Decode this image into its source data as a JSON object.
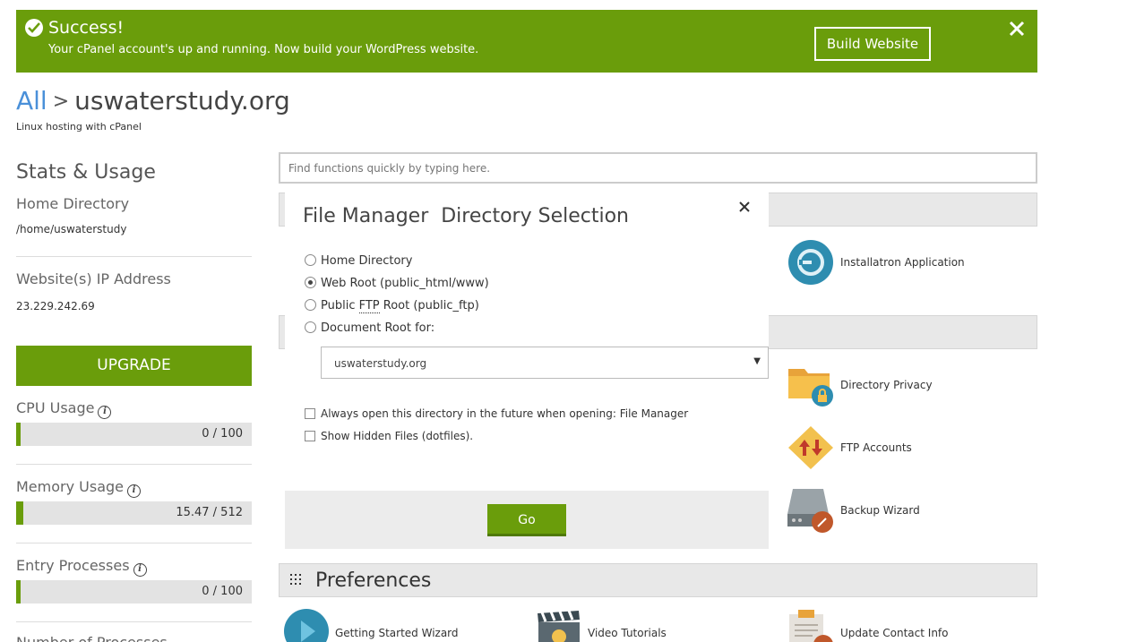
{
  "banner": {
    "title": "Success!",
    "message": "Your cPanel account's up and running. Now build your WordPress website.",
    "build_label": "Build Website"
  },
  "breadcrumb": {
    "all": "All",
    "separator": ">",
    "domain": "uswaterstudy.org",
    "subtitle": "Linux hosting with cPanel"
  },
  "sidebar": {
    "heading": "Stats & Usage",
    "home_dir_label": "Home Directory",
    "home_dir_value": "/home/uswaterstudy",
    "ip_label": "Website(s) IP Address",
    "ip_value": "23.229.242.69",
    "upgrade_label": "UPGRADE",
    "cpu_label": "CPU Usage",
    "cpu_value": "0 / 100",
    "memory_label": "Memory Usage",
    "memory_value": "15.47 / 512",
    "entry_label": "Entry Processes",
    "entry_value": "0 / 100",
    "next_label": "Number of Processes"
  },
  "search": {
    "placeholder": "Find functions quickly by typing here."
  },
  "apps": {
    "installatron": "Installatron Application",
    "directory_privacy": "Directory Privacy",
    "ftp_accounts": "FTP Accounts",
    "backup_wizard": "Backup Wizard"
  },
  "preferences": {
    "title": "Preferences",
    "items": [
      "Getting Started Wizard",
      "Video Tutorials",
      "Update Contact Info"
    ]
  },
  "modal": {
    "title": "File Manager  Directory Selection",
    "options": [
      {
        "label": "Home Directory",
        "selected": false
      },
      {
        "label": "Web Root (public_html/www)",
        "selected": true
      },
      {
        "label_pre": "Public ",
        "label_abbr": "FTP",
        "label_post": " Root (public_ftp)",
        "selected": false
      },
      {
        "label": "Document Root for:",
        "selected": false
      }
    ],
    "select_value": "uswaterstudy.org",
    "checkboxes": [
      "Always open this directory in the future when opening: File Manager",
      "Show Hidden Files (dotfiles)."
    ],
    "go_label": "Go"
  },
  "colors": {
    "brand_green": "#6a9d0b",
    "link_blue": "#4a90d9"
  }
}
